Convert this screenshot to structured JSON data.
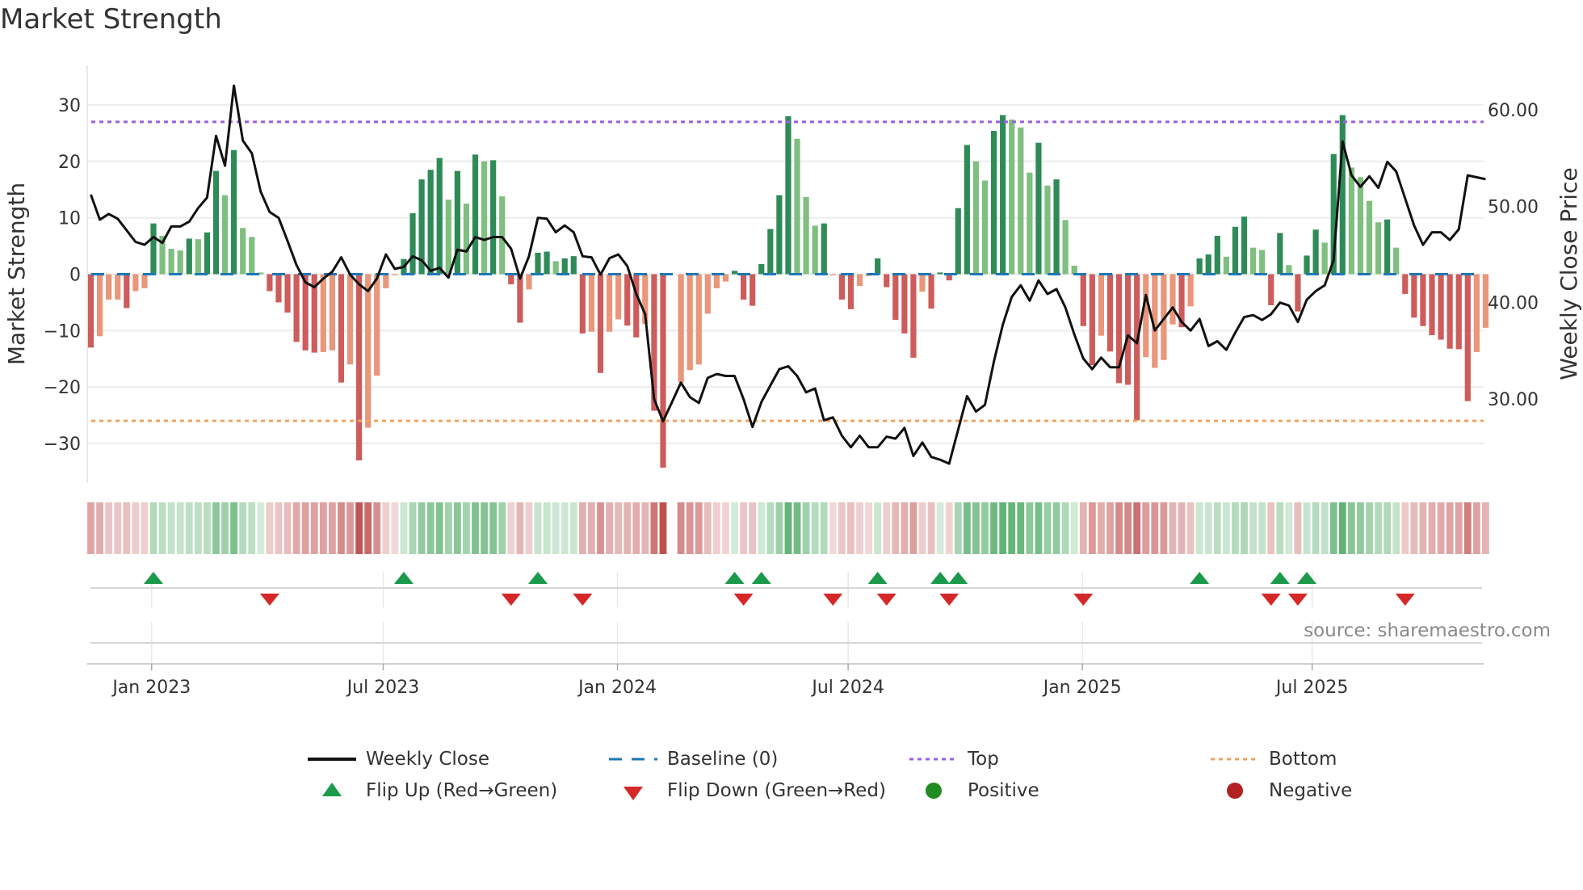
{
  "title": "Market Strength",
  "source": "source: sharemaestro.com",
  "colors": {
    "strong_green": "#2e8b57",
    "weak_green": "#7fbf7f",
    "strong_red": "#cd5c5c",
    "weak_red": "#e9967a",
    "line": "#111111",
    "baseline": "#1f77b4",
    "top": "#9b5fe0",
    "bottom": "#f0a35e",
    "flip_up": "#1a9a4a",
    "flip_down": "#d62728",
    "positive": "#228b22",
    "negative": "#b22222"
  },
  "legend": [
    {
      "label": "Weekly Close",
      "symbol": "line"
    },
    {
      "label": "Baseline (0)",
      "symbol": "dash"
    },
    {
      "label": "Top",
      "symbol": "dot-purple"
    },
    {
      "label": "Bottom",
      "symbol": "dot-orange"
    },
    {
      "label": "Flip Up (Red→Green)",
      "symbol": "triangle-up"
    },
    {
      "label": "Flip Down (Green→Red)",
      "symbol": "triangle-down"
    },
    {
      "label": "Positive",
      "symbol": "circle-green"
    },
    {
      "label": "Negative",
      "symbol": "circle-red"
    }
  ],
  "chart_data": {
    "type": "bar",
    "title": "Market Strength",
    "ylabel": "Market Strength",
    "y2label": "Weekly Close Price",
    "ylim": [
      -37,
      37
    ],
    "y2lim": [
      21.3,
      64.6
    ],
    "yticks": [
      30,
      20,
      10,
      0,
      -10,
      -20,
      -30
    ],
    "ytick_labels": [
      "30",
      "20",
      "10",
      "0",
      "−10",
      "−20",
      "−30"
    ],
    "y2ticks": [
      60,
      50,
      40,
      30
    ],
    "y2tick_labels": [
      "60.00",
      "50.00",
      "40.00",
      "30.00"
    ],
    "xticks": [
      {
        "week": 6.8,
        "label": "Jan 2023"
      },
      {
        "week": 32.7,
        "label": "Jul 2023"
      },
      {
        "week": 58.9,
        "label": "Jan 2024"
      },
      {
        "week": 84.7,
        "label": "Jul 2024"
      },
      {
        "week": 110.9,
        "label": "Jan 2025"
      },
      {
        "week": 136.6,
        "label": "Jul 2025"
      }
    ],
    "top_level": 27,
    "bottom_level": -26,
    "baseline": 0,
    "strength": [
      -13,
      -11,
      -4.5,
      -4.5,
      -6,
      -3,
      -2.5,
      9,
      6.8,
      4.5,
      4.2,
      6.3,
      6.2,
      7.4,
      18.3,
      14,
      22,
      8.2,
      6.6,
      0.3,
      -3,
      -5,
      -6.8,
      -12,
      -13.5,
      -13.9,
      -13.8,
      -13.5,
      -19.2,
      -16,
      -33,
      -27.2,
      -18,
      -2.5,
      -0.2,
      2.7,
      10.8,
      16.8,
      18.5,
      20.6,
      13.2,
      18.3,
      12.5,
      21.2,
      20,
      20.2,
      13.8,
      -1.8,
      -8.6,
      -2.7,
      3.8,
      4,
      2.3,
      2.8,
      3.2,
      -10.5,
      -10.2,
      -17.5,
      -10.2,
      -8,
      -9.1,
      -11.2,
      -8.8,
      -24.2,
      -34.3,
      0,
      -19.2,
      -17,
      -16,
      -7,
      -2.5,
      -1.3,
      0.6,
      -4.5,
      -5.6,
      1.8,
      8,
      14,
      28,
      24,
      13.7,
      8.6,
      9,
      -0.2,
      -4.5,
      -6.2,
      -2.1,
      -0.3,
      2.8,
      -2.3,
      -8.1,
      -10.5,
      -14.8,
      -3.1,
      -6.1,
      0.3,
      -1.1,
      11.7,
      22.9,
      20,
      16.6,
      25.4,
      28.2,
      27.4,
      26,
      18,
      23.3,
      15.7,
      16.8,
      9.6,
      1.5,
      -9.2,
      -16.1,
      -10.9,
      -13.7,
      -19.3,
      -19.6,
      -25.9,
      -14.7,
      -16.6,
      -15.2,
      -8.9,
      -9.4,
      -5.7,
      2.8,
      3.5,
      6.8,
      3.1,
      8.4,
      10.2,
      4.7,
      4.3,
      -5.5,
      7.3,
      1.6,
      -6.6,
      3.3,
      7.9,
      5.6,
      21.3,
      28.2,
      18.9,
      17.2,
      13,
      9.2,
      9.7,
      4.7,
      -3.5,
      -7.7,
      -9.2,
      -10.8,
      -11.6,
      -13.2,
      -13.3,
      -22.5,
      -13.8,
      -9.5
    ],
    "strong": [
      1,
      0,
      0,
      0,
      1,
      0,
      0,
      1,
      0,
      0,
      0,
      1,
      0,
      1,
      1,
      0,
      1,
      0,
      0,
      0,
      1,
      1,
      1,
      1,
      1,
      1,
      0,
      0,
      1,
      0,
      1,
      0,
      0,
      0,
      0,
      1,
      1,
      1,
      1,
      1,
      0,
      1,
      0,
      1,
      0,
      1,
      0,
      1,
      1,
      0,
      1,
      1,
      0,
      1,
      1,
      1,
      0,
      1,
      0,
      0,
      1,
      1,
      0,
      1,
      1,
      0,
      0,
      0,
      0,
      0,
      0,
      0,
      1,
      1,
      1,
      1,
      1,
      1,
      1,
      0,
      0,
      0,
      1,
      0,
      1,
      1,
      0,
      0,
      1,
      1,
      1,
      1,
      1,
      0,
      1,
      1,
      1,
      1,
      1,
      0,
      0,
      1,
      1,
      0,
      0,
      0,
      1,
      0,
      1,
      0,
      0,
      1,
      1,
      0,
      1,
      1,
      1,
      1,
      0,
      0,
      0,
      0,
      1,
      0,
      1,
      1,
      1,
      0,
      1,
      1,
      0,
      0,
      1,
      1,
      0,
      1,
      1,
      1,
      0,
      1,
      1,
      0,
      0,
      0,
      0,
      1,
      0,
      1,
      1,
      1,
      1,
      1,
      1,
      1,
      1,
      0,
      0
    ],
    "weekly_close": [
      51.2,
      48.6,
      49.2,
      48.7,
      47.5,
      46.3,
      46.0,
      46.8,
      46.2,
      47.9,
      47.9,
      48.4,
      49.8,
      50.9,
      57.3,
      54.2,
      62.5,
      56.8,
      55.5,
      51.5,
      49.4,
      48.8,
      46.4,
      43.9,
      42.1,
      41.6,
      42.5,
      43.2,
      44.7,
      42.9,
      41.9,
      41.2,
      42.5,
      45.0,
      43.5,
      43.7,
      44.8,
      44.4,
      43.3,
      43.6,
      42.6,
      45.5,
      45.3,
      46.8,
      46.5,
      46.8,
      46.8,
      45.6,
      42.5,
      44.8,
      48.8,
      48.7,
      47.3,
      48.0,
      47.3,
      44.8,
      44.7,
      42.9,
      44.6,
      45.0,
      43.8,
      40.9,
      38.8,
      30.0,
      27.7,
      29.7,
      31.7,
      30.2,
      29.6,
      32.2,
      32.6,
      32.4,
      32.4,
      30.0,
      27.1,
      29.7,
      31.4,
      33.1,
      33.4,
      32.4,
      30.7,
      31.1,
      27.8,
      28.1,
      26.2,
      25.0,
      26.2,
      25.0,
      25.0,
      26.1,
      25.9,
      27.0,
      24.1,
      25.5,
      24.0,
      23.7,
      23.3,
      26.8,
      30.3,
      28.7,
      29.4,
      33.9,
      37.7,
      40.6,
      41.8,
      40.2,
      42.3,
      40.9,
      41.4,
      39.5,
      36.7,
      34.2,
      33.1,
      34.3,
      33.3,
      33.3,
      36.6,
      35.8,
      40.8,
      37.1,
      38.3,
      39.5,
      38.0,
      37.1,
      38.3,
      35.5,
      36.0,
      35.1,
      36.9,
      38.5,
      38.7,
      38.2,
      38.8,
      40.0,
      39.7,
      38.0,
      40.3,
      41.2,
      41.8,
      44.4,
      56.7,
      53.2,
      52.0,
      53.1,
      51.9,
      54.6,
      53.6,
      50.8,
      48.0,
      46.0,
      47.3,
      47.3,
      46.5,
      47.6,
      53.2,
      53.0,
      52.8
    ],
    "flip_up_weeks": [
      7,
      35,
      50,
      72,
      75,
      88,
      95,
      97,
      124,
      133,
      136
    ],
    "flip_down_weeks": [
      20,
      47,
      55,
      73,
      83,
      89,
      96,
      111,
      132,
      135,
      147
    ]
  }
}
